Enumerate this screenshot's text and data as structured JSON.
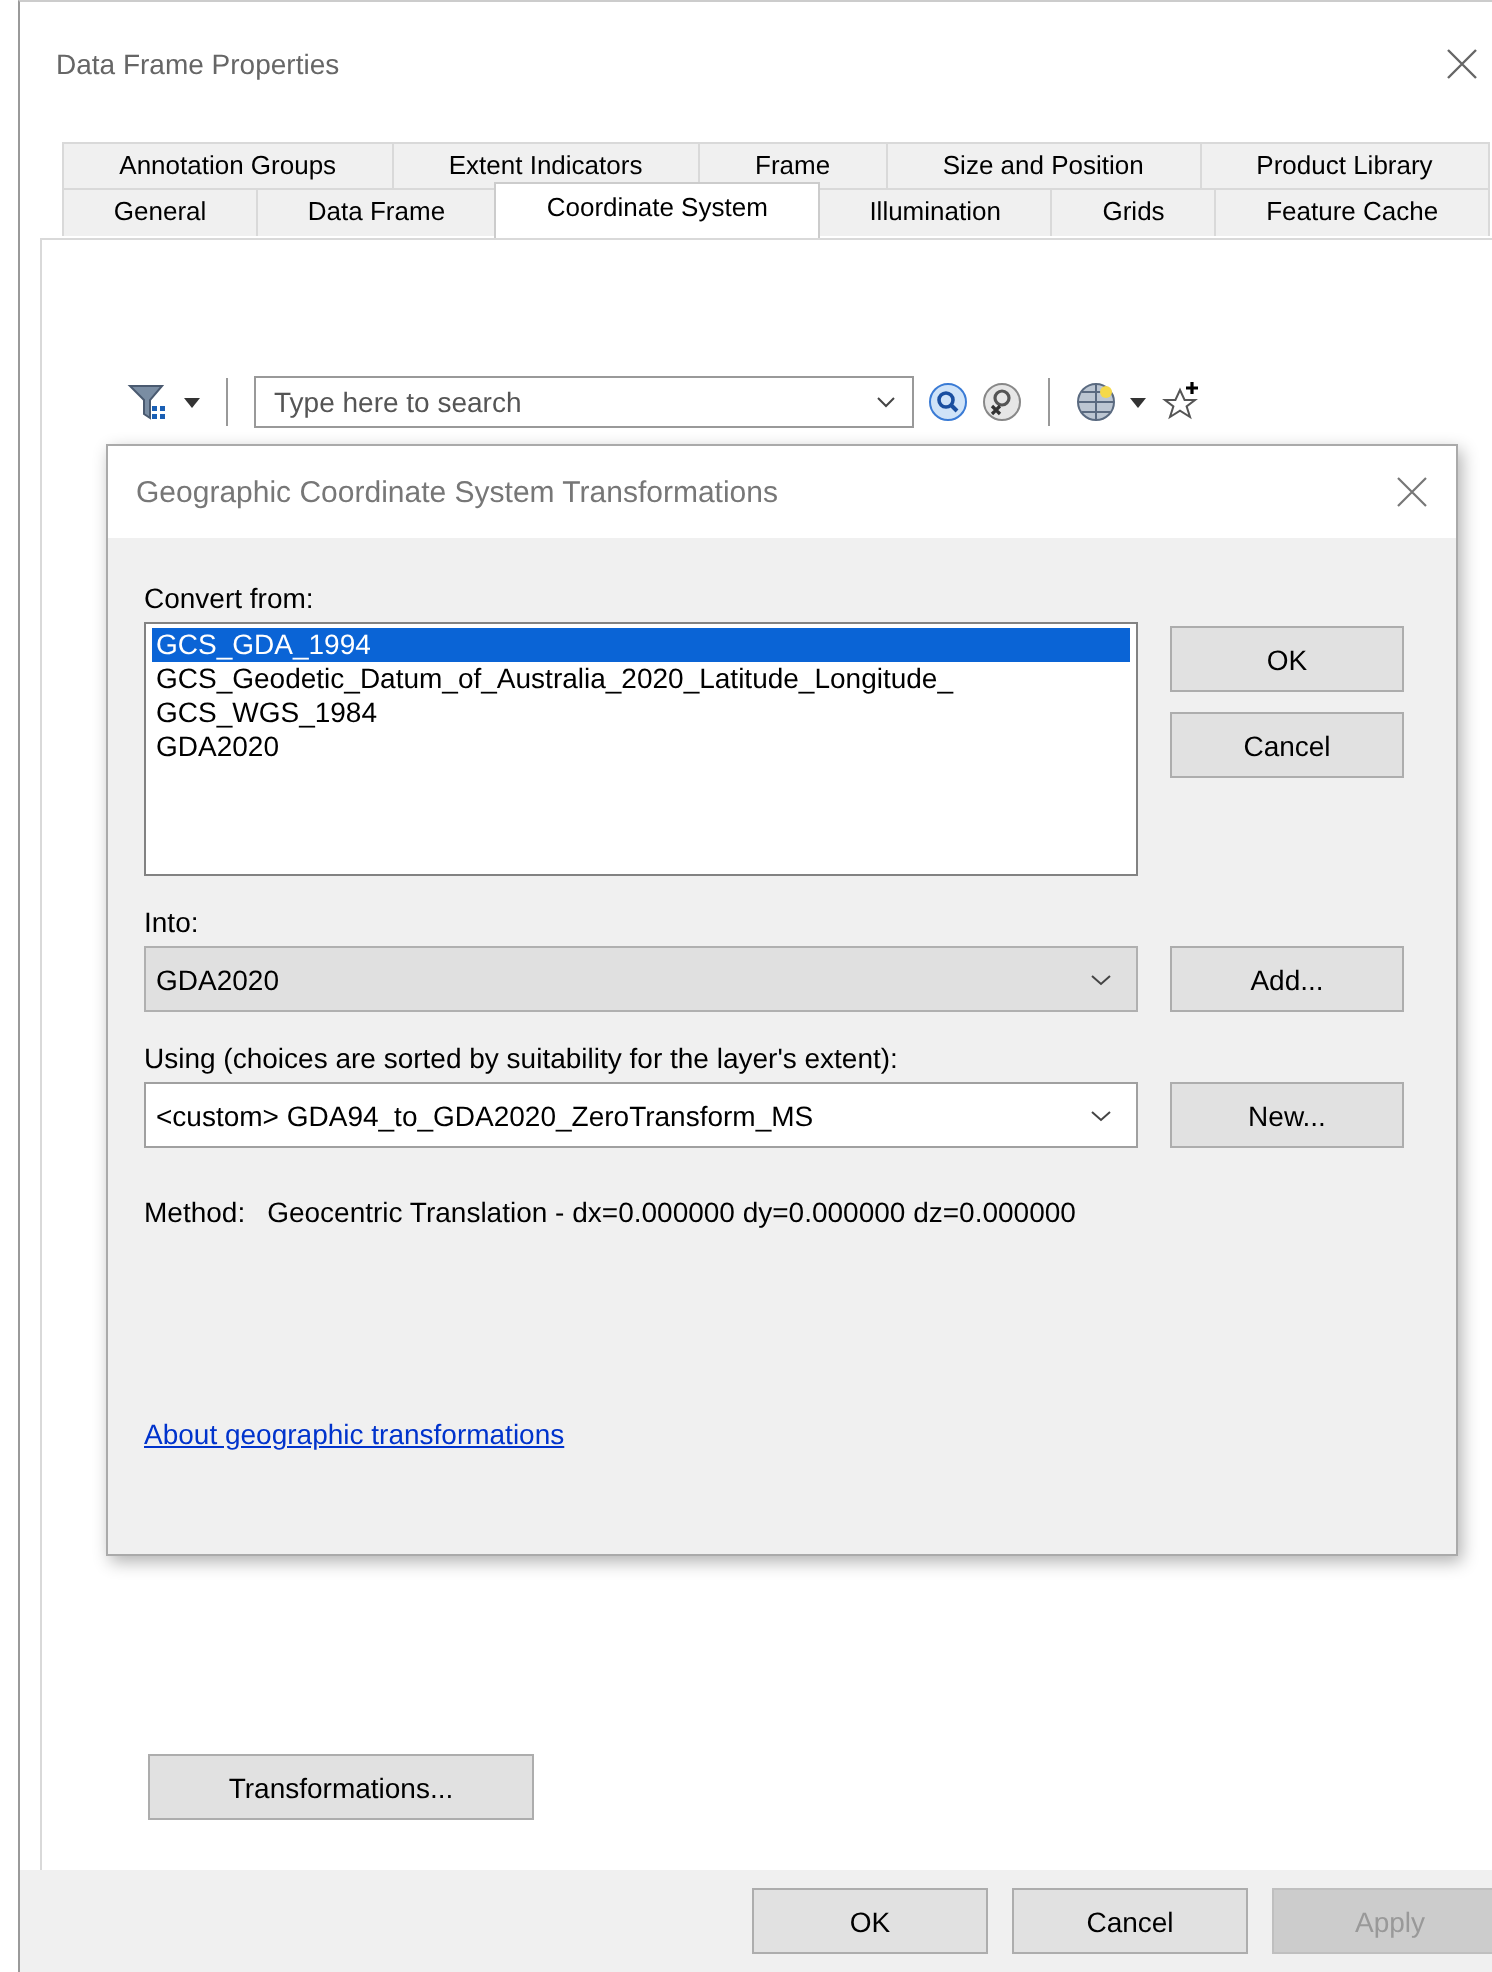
{
  "window": {
    "title": "Data Frame Properties"
  },
  "tab_rows": [
    [
      {
        "label": "Annotation Groups",
        "selected": false
      },
      {
        "label": "Extent Indicators",
        "selected": false
      },
      {
        "label": "Frame",
        "selected": false
      },
      {
        "label": "Size and Position",
        "selected": false
      },
      {
        "label": "Product Library",
        "selected": false
      }
    ],
    [
      {
        "label": "General",
        "selected": false
      },
      {
        "label": "Data Frame",
        "selected": false
      },
      {
        "label": "Coordinate System",
        "selected": true
      },
      {
        "label": "Illumination",
        "selected": false
      },
      {
        "label": "Grids",
        "selected": false
      },
      {
        "label": "Feature Cache",
        "selected": false
      }
    ]
  ],
  "toolbar": {
    "search": {
      "placeholder": "Type here to search"
    }
  },
  "dialog": {
    "title": "Geographic Coordinate System Transformations",
    "convert_from": {
      "label": "Convert from:",
      "items": [
        {
          "text": "GCS_GDA_1994",
          "selected": true
        },
        {
          "text": "GCS_Geodetic_Datum_of_Australia_2020_Latitude_Longitude_",
          "selected": false
        },
        {
          "text": "GCS_WGS_1984",
          "selected": false
        },
        {
          "text": "GDA2020",
          "selected": false
        }
      ]
    },
    "side_buttons": [
      "OK",
      "Cancel"
    ],
    "into": {
      "label": "Into:",
      "value": "GDA2020",
      "button": "Add..."
    },
    "using": {
      "label": "Using (choices are sorted by suitability for the layer's extent):",
      "value": "<custom> GDA94_to_GDA2020_ZeroTransform_MS",
      "button": "New..."
    },
    "method": {
      "label": "Method:",
      "value": "Geocentric Translation - dx=0.000000 dy=0.000000 dz=0.000000"
    },
    "link": "About geographic transformations"
  },
  "transformations_button": "Transformations...",
  "footer_buttons": [
    {
      "label": "OK",
      "disabled": false
    },
    {
      "label": "Cancel",
      "disabled": false
    },
    {
      "label": "Apply",
      "disabled": true
    }
  ]
}
